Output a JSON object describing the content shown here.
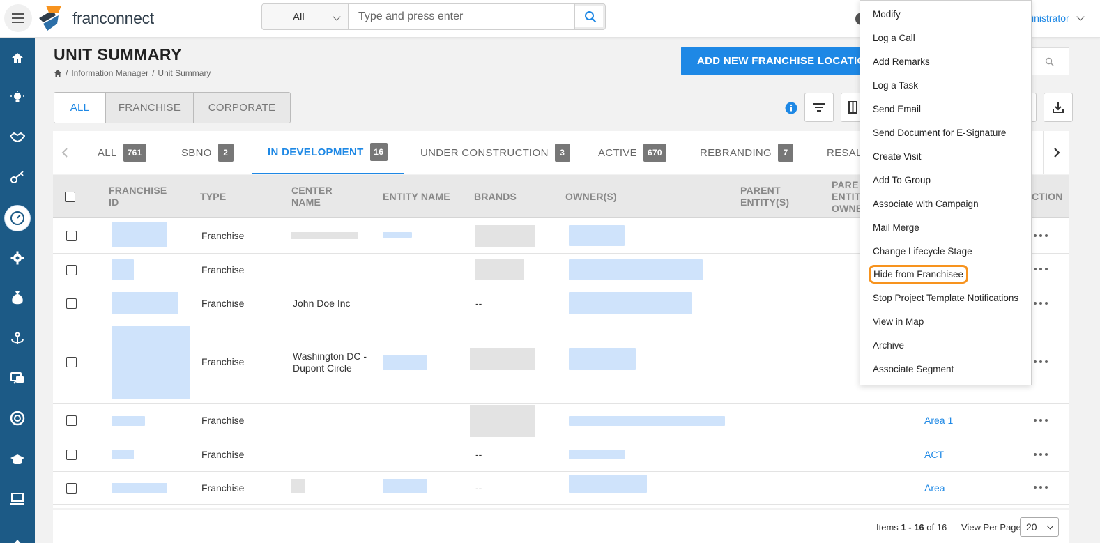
{
  "header": {
    "logo_text": "franconnect",
    "search_scope": "All",
    "search_placeholder": "Type and press enter",
    "user_label": "inistrator"
  },
  "sidebar": {
    "icons": [
      "home-icon",
      "lightbulb-icon",
      "handshake-icon",
      "key-icon",
      "dashboard-icon",
      "gear-icon",
      "money-bag-icon",
      "anchor-icon",
      "chat-icon",
      "support-icon",
      "graduation-cap-icon",
      "monitor-icon"
    ]
  },
  "page": {
    "title": "UNIT SUMMARY",
    "breadcrumb": [
      "Information Manager",
      "Unit Summary"
    ],
    "add_button": "ADD NEW FRANCHISE LOCATION"
  },
  "scope_tabs": [
    {
      "label": "ALL",
      "active": true
    },
    {
      "label": "FRANCHISE",
      "active": false
    },
    {
      "label": "CORPORATE",
      "active": false
    }
  ],
  "status_tabs": [
    {
      "label": "ALL",
      "count": "761"
    },
    {
      "label": "SBNO",
      "count": "2"
    },
    {
      "label": "IN DEVELOPMENT",
      "count": "16",
      "active": true
    },
    {
      "label": "UNDER CONSTRUCTION",
      "count": "3"
    },
    {
      "label": "ACTIVE",
      "count": "670"
    },
    {
      "label": "REBRANDING",
      "count": "7"
    },
    {
      "label": "RESAL",
      "count": ""
    }
  ],
  "table": {
    "columns": [
      "FRANCHISE ID",
      "TYPE",
      "CENTER NAME",
      "ENTITY NAME",
      "BRANDS",
      "OWNER(S)",
      "PARENT ENTITY(S)",
      "PARE ENTIT OWNE",
      "CTION"
    ],
    "rows": [
      {
        "type": "Franchise",
        "center_name": "",
        "brands": "",
        "area": ""
      },
      {
        "type": "Franchise",
        "center_name": "",
        "brands": "",
        "area": ""
      },
      {
        "type": "Franchise",
        "center_name": "John Doe Inc",
        "brands": "--",
        "area": ""
      },
      {
        "type": "Franchise",
        "center_name": "Washington DC - Dupont Circle",
        "brands": "",
        "area": ""
      },
      {
        "type": "Franchise",
        "center_name": "",
        "brands": "",
        "area": "Area 1"
      },
      {
        "type": "Franchise",
        "center_name": "",
        "brands": "--",
        "area": "ACT"
      },
      {
        "type": "Franchise",
        "center_name": "",
        "brands": "--",
        "area": "Area"
      }
    ]
  },
  "footer": {
    "items_prefix": "Items ",
    "items_range": "1 - 16",
    "items_suffix": " of 16",
    "view_per_page_label": "View Per Page",
    "view_per_page_value": "20"
  },
  "action_menu": {
    "items": [
      "Modify",
      "Log a Call",
      "Add Remarks",
      "Log a Task",
      "Send Email",
      "Send Document for E-Signature",
      "Create Visit",
      "Add To Group",
      "Associate with Campaign",
      "Mail Merge",
      "Change Lifecycle Stage",
      "Hide from Franchisee",
      "Stop Project Template Notifications",
      "View in Map",
      "Archive",
      "Associate Segment"
    ],
    "highlighted": "Hide from Franchisee",
    "highlight_color": "#f7931e"
  },
  "colors": {
    "accent": "#1e88e5",
    "sidebar": "#1c5a86"
  }
}
